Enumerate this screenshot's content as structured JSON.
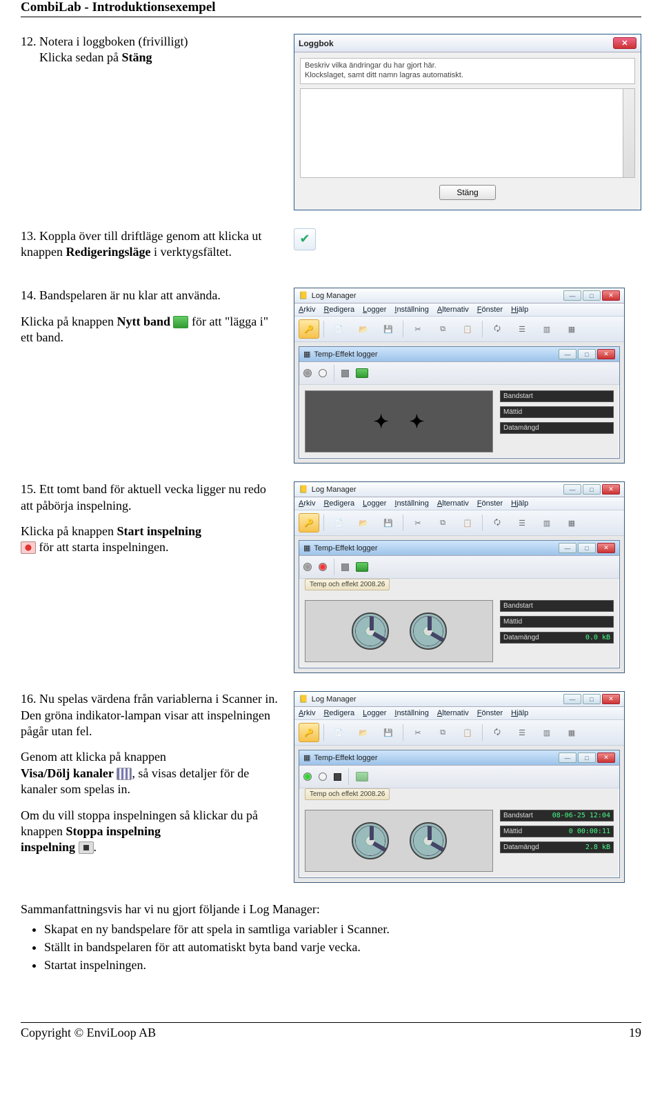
{
  "header": {
    "title": "CombiLab - Introduktionsexempel"
  },
  "step12": {
    "num": "12.",
    "line1": "Notera i loggboken (frivilligt)",
    "line2": "Klicka sedan på ",
    "bold_close": "Stäng"
  },
  "loggbok": {
    "title": "Loggbok",
    "info1": "Beskriv vilka ändringar du har gjort här.",
    "info2": "Klockslaget, samt ditt namn lagras automatiskt.",
    "close_btn": "Stäng"
  },
  "step13": {
    "num": "13.",
    "line1": "Koppla över till driftläge genom att klicka ut knappen ",
    "bold": "Redigeringsläge",
    "line2": " i verktygsfältet."
  },
  "step14": {
    "num": "14.",
    "line1": "Bandspelaren är nu klar att använda.",
    "line2a": "Klicka på knappen ",
    "bold": "Nytt band",
    "line2b": " för att \"lägga i\" ett band."
  },
  "step15": {
    "num": "15.",
    "line1": "Ett tomt band för aktuell vecka ligger nu redo att påbörja inspelning.",
    "line2a": "Klicka på knappen ",
    "bold": "Start inspelning",
    "line2b": " för att starta inspelningen."
  },
  "step16": {
    "num": "16.",
    "line1": "Nu spelas värdena från variablerna i Scanner in. Den gröna indikator-lampan visar att inspelningen pågår utan fel.",
    "line2a": "Genom att klicka på knappen ",
    "bold1": "Visa/Dölj kanaler",
    "line2b": ", så visas detaljer för de kanaler som spelas in.",
    "line3a": "Om du vill stoppa inspelningen så klickar du på knappen ",
    "bold2": "Stoppa inspelning",
    "line3b": "."
  },
  "logmanager": {
    "title": "Log Manager",
    "menu": [
      "Arkiv",
      "Redigera",
      "Logger",
      "Inställning",
      "Alternativ",
      "Fönster",
      "Hjälp"
    ],
    "logger_tab": "Temp-Effekt logger",
    "fields": {
      "bandstart": "Bandstart",
      "mattid": "Mättid",
      "datamangd": "Datamängd"
    },
    "tape_label": "Temp och effekt 2008.26",
    "vals15": {
      "data": "0.0 kB"
    },
    "vals16": {
      "bandstart": "08-06-25 12:04",
      "mattid": "0  00:00:11",
      "data": "2.8 kB"
    }
  },
  "summary": {
    "intro": "Sammanfattningsvis har vi nu gjort följande i Log Manager:",
    "items": [
      "Skapat en ny bandspelare för att spela in samtliga variabler i Scanner.",
      "Ställt in bandspelaren för att automatiskt byta band varje vecka.",
      "Startat inspelningen."
    ]
  },
  "footer": {
    "copyright": "Copyright © EnviLoop AB",
    "page": "19"
  }
}
